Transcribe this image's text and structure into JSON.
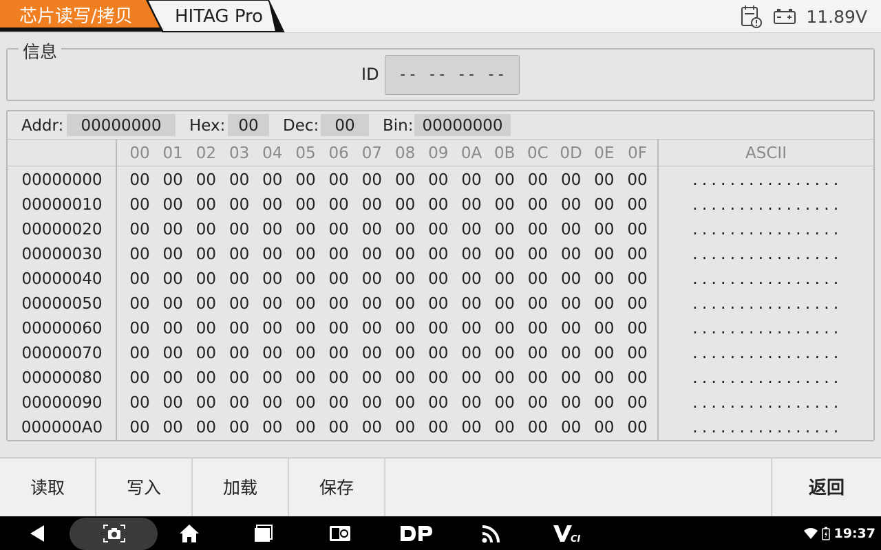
{
  "header": {
    "breadcrumb_1": "芯片读写/拷贝",
    "breadcrumb_2": "HITAG Pro",
    "voltage": "11.89V",
    "accent_color": "#f07f22"
  },
  "info": {
    "legend": "信息",
    "id_label": "ID",
    "id_value": "-- -- -- --"
  },
  "fields": {
    "addr_label": "Addr:",
    "addr_value": "00000000",
    "hex_label": "Hex:",
    "hex_value": "00",
    "dec_label": "Dec:",
    "dec_value": "00",
    "bin_label": "Bin:",
    "bin_value": "00000000"
  },
  "table": {
    "columns": [
      "00",
      "01",
      "02",
      "03",
      "04",
      "05",
      "06",
      "07",
      "08",
      "09",
      "0A",
      "0B",
      "0C",
      "0D",
      "0E",
      "0F"
    ],
    "ascii_header": "ASCII",
    "rows": [
      {
        "addr": "00000000",
        "bytes": [
          "00",
          "00",
          "00",
          "00",
          "00",
          "00",
          "00",
          "00",
          "00",
          "00",
          "00",
          "00",
          "00",
          "00",
          "00",
          "00"
        ],
        "ascii": "................"
      },
      {
        "addr": "00000010",
        "bytes": [
          "00",
          "00",
          "00",
          "00",
          "00",
          "00",
          "00",
          "00",
          "00",
          "00",
          "00",
          "00",
          "00",
          "00",
          "00",
          "00"
        ],
        "ascii": "................"
      },
      {
        "addr": "00000020",
        "bytes": [
          "00",
          "00",
          "00",
          "00",
          "00",
          "00",
          "00",
          "00",
          "00",
          "00",
          "00",
          "00",
          "00",
          "00",
          "00",
          "00"
        ],
        "ascii": "................"
      },
      {
        "addr": "00000030",
        "bytes": [
          "00",
          "00",
          "00",
          "00",
          "00",
          "00",
          "00",
          "00",
          "00",
          "00",
          "00",
          "00",
          "00",
          "00",
          "00",
          "00"
        ],
        "ascii": "................"
      },
      {
        "addr": "00000040",
        "bytes": [
          "00",
          "00",
          "00",
          "00",
          "00",
          "00",
          "00",
          "00",
          "00",
          "00",
          "00",
          "00",
          "00",
          "00",
          "00",
          "00"
        ],
        "ascii": "................"
      },
      {
        "addr": "00000050",
        "bytes": [
          "00",
          "00",
          "00",
          "00",
          "00",
          "00",
          "00",
          "00",
          "00",
          "00",
          "00",
          "00",
          "00",
          "00",
          "00",
          "00"
        ],
        "ascii": "................"
      },
      {
        "addr": "00000060",
        "bytes": [
          "00",
          "00",
          "00",
          "00",
          "00",
          "00",
          "00",
          "00",
          "00",
          "00",
          "00",
          "00",
          "00",
          "00",
          "00",
          "00"
        ],
        "ascii": "................"
      },
      {
        "addr": "00000070",
        "bytes": [
          "00",
          "00",
          "00",
          "00",
          "00",
          "00",
          "00",
          "00",
          "00",
          "00",
          "00",
          "00",
          "00",
          "00",
          "00",
          "00"
        ],
        "ascii": "................"
      },
      {
        "addr": "00000080",
        "bytes": [
          "00",
          "00",
          "00",
          "00",
          "00",
          "00",
          "00",
          "00",
          "00",
          "00",
          "00",
          "00",
          "00",
          "00",
          "00",
          "00"
        ],
        "ascii": "................"
      },
      {
        "addr": "00000090",
        "bytes": [
          "00",
          "00",
          "00",
          "00",
          "00",
          "00",
          "00",
          "00",
          "00",
          "00",
          "00",
          "00",
          "00",
          "00",
          "00",
          "00"
        ],
        "ascii": "................"
      },
      {
        "addr": "000000A0",
        "bytes": [
          "00",
          "00",
          "00",
          "00",
          "00",
          "00",
          "00",
          "00",
          "00",
          "00",
          "00",
          "00",
          "00",
          "00",
          "00",
          "00"
        ],
        "ascii": "................"
      }
    ]
  },
  "buttons": {
    "read": "读取",
    "write": "写入",
    "load": "加载",
    "save": "保存",
    "return": "返回"
  },
  "navbar": {
    "time": "19:37",
    "icons": [
      "back-icon",
      "screenshot-camera-icon",
      "home-icon",
      "recent-apps-icon",
      "display-icon",
      "dp-logo-icon",
      "rss-feed-icon",
      "vci-icon",
      "wifi-icon",
      "battery-icon"
    ]
  }
}
